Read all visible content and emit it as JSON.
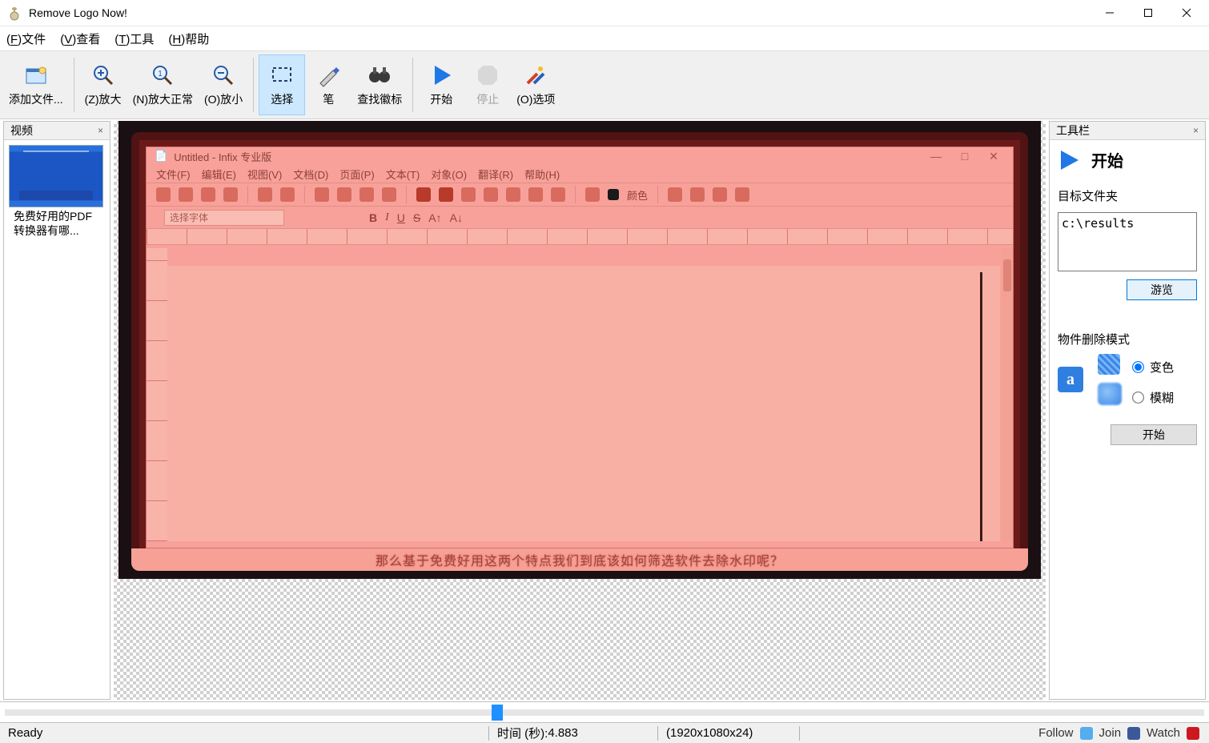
{
  "app": {
    "title": "Remove Logo Now!"
  },
  "window_controls": {
    "min": "minimize",
    "max": "maximize",
    "close": "close"
  },
  "menu": {
    "file": {
      "key": "F",
      "label": "文件"
    },
    "view": {
      "key": "V",
      "label": "查看"
    },
    "tools": {
      "key": "T",
      "label": "工具"
    },
    "help": {
      "key": "H",
      "label": "帮助"
    }
  },
  "toolbar": {
    "add_files": "添加文件...",
    "zoom_in": "(Z)放大",
    "zoom_normal": "(N)放大正常",
    "zoom_out": "(O)放小",
    "select": "选择",
    "pen": "笔",
    "find_logo": "查找徽标",
    "start": "开始",
    "stop": "停止",
    "options": "(O)选项"
  },
  "video_panel": {
    "title": "视频",
    "item_label": "免费好用的PDF转换器有哪..."
  },
  "preview": {
    "infix_title": "Untitled - Infix 专业版",
    "infix_menu": [
      "文件(F)",
      "编辑(E)",
      "视图(V)",
      "文档(D)",
      "页面(P)",
      "文本(T)",
      "对象(O)",
      "翻译(R)",
      "帮助(H)"
    ],
    "infix_font_placeholder": "选择字体",
    "infix_color_label": "颜色",
    "caption": "那么基于免费好用这两个特点我们到底该如何筛选软件去除水印呢？"
  },
  "tool_panel": {
    "title": "工具栏",
    "start": "开始",
    "target_folder_label": "目标文件夹",
    "target_folder_value": "c:\\results",
    "browse": "游览",
    "mode_label": "物件删除模式",
    "mode_color": "变色",
    "mode_blur": "模糊",
    "start_button": "开始"
  },
  "timeline": {
    "position_percent": 40.6
  },
  "status": {
    "ready": "Ready",
    "time_label": "时间 (秒): ",
    "time_value": "4.883",
    "dimensions": "(1920x1080x24)",
    "follow": "Follow",
    "join": "Join",
    "watch": "Watch"
  }
}
